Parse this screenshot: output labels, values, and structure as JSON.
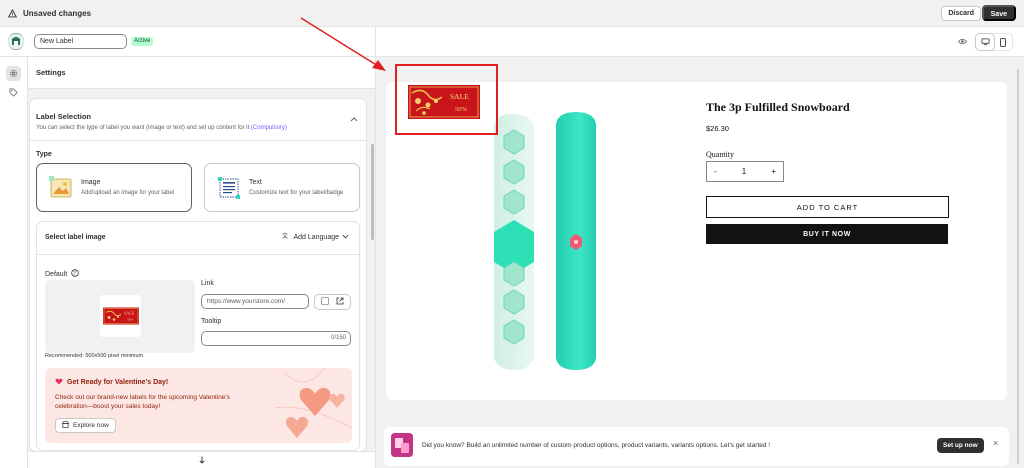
{
  "topbar": {
    "title": "Unsaved changes",
    "discard": "Discard",
    "save": "Save"
  },
  "appbar": {
    "label_name": "New Label",
    "status": "Active"
  },
  "panel": {
    "heading": "Settings",
    "section_title": "Label Selection",
    "section_sub": "You can select the type of label you want (image or text) and set up content for it",
    "compulsory": "(Compulsory)",
    "type_label": "Type",
    "types": [
      {
        "title": "Image",
        "desc": "Add/upload an image for your label"
      },
      {
        "title": "Text",
        "desc": "Customize text for your label/badge"
      }
    ],
    "select_image_title": "Select label image",
    "add_language": "Add Language",
    "default_label": "Default",
    "recommended": "Recommended: 500x500 pixel minimum.",
    "link_label": "Link",
    "link_placeholder": "https://www.yourstore.com/",
    "tooltip_label": "Tooltip",
    "tooltip_count": "0/150",
    "promo": {
      "title": "Get Ready for Valentine's Day!",
      "body": "Check out our brand-new labels for the upcoming Valentine's celebration—boost your sales today!",
      "button": "Explore now"
    }
  },
  "preview": {
    "product_title": "The 3p Fulfilled Snowboard",
    "price": "$26.30",
    "quantity_label": "Quantity",
    "qty_minus": "-",
    "qty_value": "1",
    "qty_plus": "+",
    "add_to_cart": "ADD TO CART",
    "buy_now": "BUY IT NOW",
    "sale_text": "SALE",
    "sale_pct": "50%"
  },
  "banner": {
    "text": "Did you know? Build an unlimited number of custom product options, product variants, variants options. Let's get started !",
    "cta": "Set up now",
    "close": "×"
  },
  "colors": {
    "accent_purple": "#8051ff",
    "active_badge": "#b4fed2",
    "highlight_red": "#e02020",
    "board_teal": "#2ed9b6"
  }
}
